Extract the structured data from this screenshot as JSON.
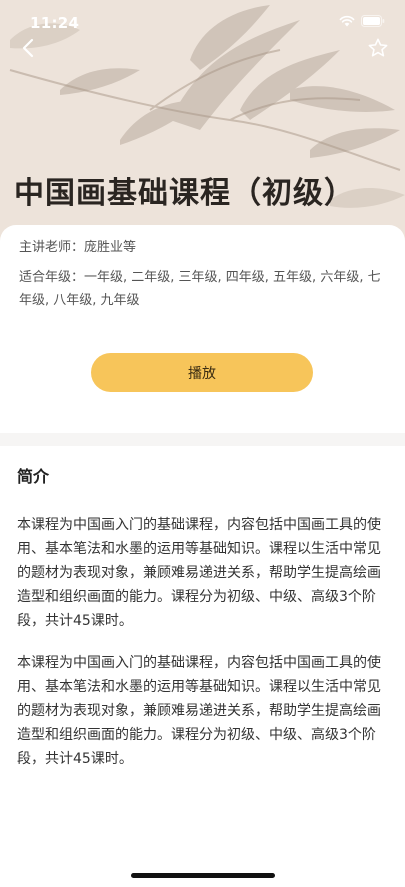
{
  "status_bar": {
    "time": "11:24"
  },
  "nav": {
    "back_icon": "chevron-left-icon",
    "favorite_icon": "star-outline-icon"
  },
  "course": {
    "title": "中国画基础课程（初级）",
    "teacher": "主讲老师：庞胜业等",
    "grades": "适合年级：一年级, 二年级, 三年级, 四年级, 五年级, 六年级, 七年级, 八年级, 九年级",
    "play_label": "播放"
  },
  "intro": {
    "heading": "简介",
    "paragraphs": [
      "本课程为中国画入门的基础课程，内容包括中国画工具的使用、基本笔法和水墨的运用等基础知识。课程以生活中常见的题材为表现对象，兼顾难易递进关系，帮助学生提高绘画造型和组织画面的能力。课程分为初级、中级、高级3个阶段，共计45课时。",
      "本课程为中国画入门的基础课程，内容包括中国画工具的使用、基本笔法和水墨的运用等基础知识。课程以生活中常见的题材为表现对象，兼顾难易递进关系，帮助学生提高绘画造型和组织画面的能力。课程分为初级、中级、高级3个阶段，共计45课时。"
    ]
  },
  "colors": {
    "hero_background": "#ede3da",
    "play_button": "#f7c55a",
    "page_background": "#f6f5f4"
  }
}
